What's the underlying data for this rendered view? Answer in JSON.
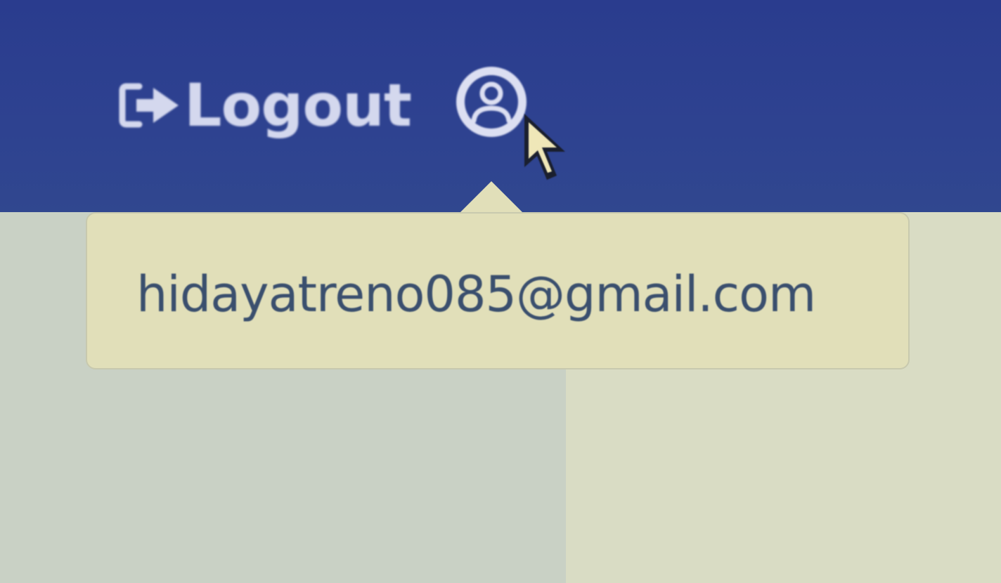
{
  "navbar": {
    "logout_label": "Logout",
    "logout_icon": "logout-icon",
    "user_icon": "user-circle-icon"
  },
  "tooltip": {
    "email": "hidayatreno085@gmail.com"
  },
  "colors": {
    "navbar_bg": "#2e4290",
    "navbar_text": "#d4d8ee",
    "tooltip_bg": "#e1dfb9",
    "tooltip_text": "#3a4f6e"
  }
}
